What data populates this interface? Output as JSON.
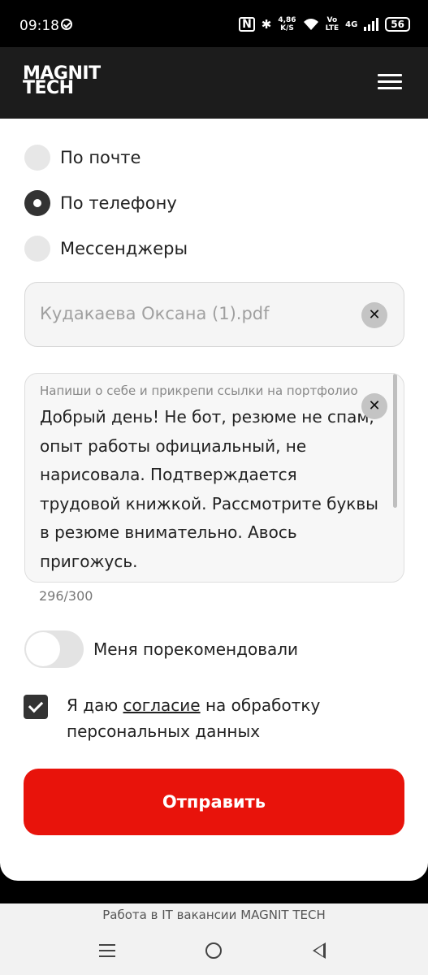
{
  "status_bar": {
    "time": "09:18",
    "speed_value": "4,86",
    "speed_unit": "K/S",
    "volte_top": "Vo",
    "volte_bottom": "LTE",
    "network": "4G",
    "battery": "56"
  },
  "header": {
    "logo_line1": "MAGNIT",
    "logo_line2": "TECH"
  },
  "form": {
    "contact_options": [
      {
        "label": "По почте",
        "selected": false
      },
      {
        "label": "По телефону",
        "selected": true
      },
      {
        "label": "Мессенджеры",
        "selected": false
      }
    ],
    "file_name": "Кудакаева Оксана (1).pdf",
    "about": {
      "label": "Напиши о себе и прикрепи ссылки на портфолио",
      "value": "Добрый день! Не бот, резюме не спам, опыт работы официальный, не нарисовала. Подтверждается трудовой книжкой. Рассмотрите буквы в резюме внимательно. Авось пригожусь.",
      "counter": "296/300"
    },
    "recommend_label": "Меня порекомендовали",
    "recommend_on": false,
    "consent_prefix": "Я даю ",
    "consent_link": "согласие",
    "consent_suffix": " на обработку персональных данных",
    "consent_checked": true,
    "submit_label": "Отправить"
  },
  "bottom": {
    "site_title": "Работа в IT вакансии MAGNIT TECH"
  },
  "colors": {
    "accent": "#e8130b",
    "header_bg": "#1c1c1c"
  }
}
